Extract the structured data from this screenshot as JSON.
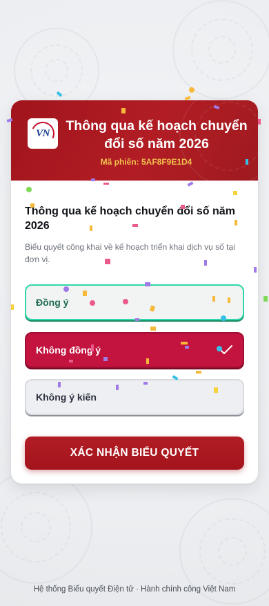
{
  "header": {
    "logo_text": "VN",
    "title": "Thông qua kế hoạch chuyển đổi số năm 2026",
    "session": "Mã phiên: 5AF8F9E1D4"
  },
  "question": {
    "title": "Thông qua kế hoạch chuyển đổi số năm 2026",
    "description": "Biểu quyết công khai về kế hoạch triển khai dịch vụ số tại đơn vị."
  },
  "options": {
    "agree": "Đồng ý",
    "disagree": "Không đồng ý",
    "abstain": "Không ý kiến",
    "selected": "disagree"
  },
  "submit_label": "XÁC NHẬN BIỂU QUYẾT",
  "footer": "Hệ thống Biểu quyết Điện tử · Hành chính công Việt Nam",
  "colors": {
    "brand_red": "#a3141c",
    "selected_red": "#c2143f",
    "agree_green": "#2fd6a8",
    "session_gold": "#f2c14e"
  }
}
